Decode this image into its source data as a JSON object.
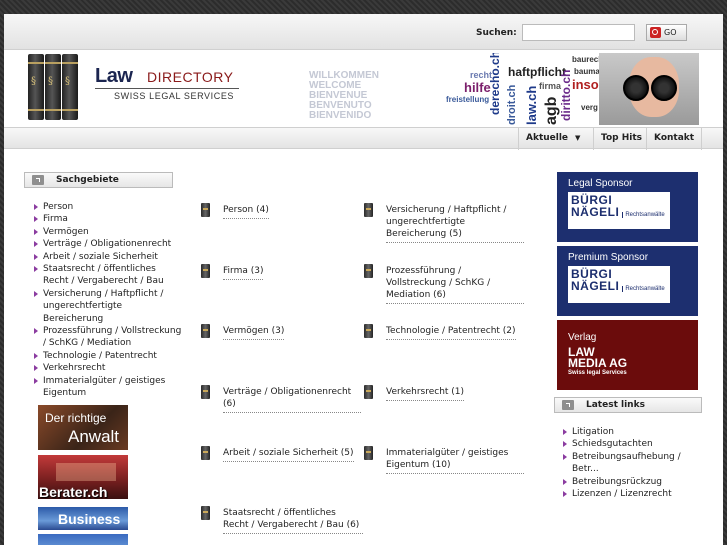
{
  "search": {
    "label": "Suchen:",
    "placeholder": "",
    "button": "GO"
  },
  "header": {
    "logo_law": "Law",
    "logo_directory": "DIRECTORY",
    "logo_sub": "SWISS LEGAL SERVICES",
    "welcome": [
      "WILLKOMMEN",
      "WELCOME",
      "BIENVENUE",
      "BENVENUTO",
      "BIENVENIDO"
    ],
    "collage_words": [
      "recht",
      "haftpflicht",
      "hilfe",
      "freistellung",
      "derecho.ch",
      "firma",
      "insolv",
      "baurechte",
      "bauma",
      "diritto.ch",
      "agb",
      "verg",
      "law.ch",
      "droit.ch"
    ]
  },
  "nav": {
    "items": [
      "Aktuelle",
      "Top Hits",
      "Kontakt"
    ]
  },
  "sidebar": {
    "title": "Sachgebiete",
    "items": [
      "Person",
      "Firma",
      "Vermögen",
      "Verträge / Obligationenrecht",
      "Arbeit / soziale Sicherheit",
      "Staatsrecht / öffentliches Recht / Vergaberecht / Bau",
      "Versicherung / Haftpflicht / ungerechtfertigte Bereicherung",
      "Prozessführung / Vollstreckung / SchKG / Mediation",
      "Technologie / Patentrecht",
      "Verkehrsrecht",
      "Immaterialgüter / geistiges Eigentum"
    ],
    "banners": [
      {
        "line1": "Der richtige",
        "line2": "Anwalt"
      },
      {
        "line1": "Berater.ch"
      },
      {
        "line1": "Business"
      }
    ]
  },
  "categories": {
    "col1": [
      "Person (4)",
      "Firma (3)",
      "Vermögen (3)",
      "Verträge / Obligationenrecht (6)",
      "Arbeit / soziale Sicherheit (5)",
      "Staatsrecht / öffentliches Recht / Vergaberecht / Bau (6)"
    ],
    "col2": [
      "Versicherung / Haftpflicht / ungerechtfertigte Bereicherung (5)",
      "Prozessführung / Vollstreckung / SchKG / Mediation (6)",
      "Technologie / Patentrecht (2)",
      "Verkehrsrecht (1)",
      "Immaterialgüter / geistiges Eigentum (10)"
    ]
  },
  "sponsors": [
    {
      "kind": "Legal Sponsor",
      "name1": "BÜRGI",
      "name2": "NÄGELI",
      "suffix": "Rechtsanwälte"
    },
    {
      "kind": "Premium Sponsor",
      "name1": "BÜRGI",
      "name2": "NÄGELI",
      "suffix": "Rechtsanwälte"
    },
    {
      "kind": "Verlag",
      "name1": "LAW",
      "name2": "MEDIA AG",
      "suffix": "Swiss legal Services"
    }
  ],
  "latest_links": {
    "title": "Latest links",
    "items": [
      "Litigation",
      "Schiedsgutachten",
      "Betreibungsaufhebung / Betr...",
      "Betreibungsrückzug",
      "Lizenzen / Lizenzrecht"
    ]
  },
  "colors": {
    "bullet": "#8b3ca0",
    "navy": "#1c2e6e",
    "sponsor_bg": "#1d2f6f",
    "verlag_bg": "#6b0c0c"
  }
}
